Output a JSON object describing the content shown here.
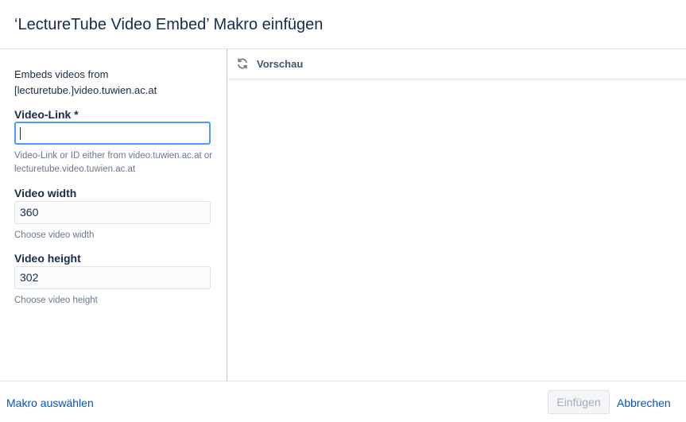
{
  "dialog": {
    "title": "‘LectureTube Video Embed’ Makro einfügen"
  },
  "form": {
    "description": "Embeds videos from [lecturetube.]video.tuwien.ac.at",
    "video_link": {
      "label": "Video-Link *",
      "value": "",
      "help": "Video-Link or ID either from video.tuwien.ac.at or lecturetube.video.tuwien.ac.at"
    },
    "video_width": {
      "label": "Video width",
      "value": "360",
      "help": "Choose video width"
    },
    "video_height": {
      "label": "Video height",
      "value": "302",
      "help": "Choose video height"
    }
  },
  "preview": {
    "label": "Vorschau",
    "icon": "refresh-icon"
  },
  "footer": {
    "select_macro_link": "Makro auswählen",
    "insert_button": "Einfügen",
    "cancel_link": "Abbrechen"
  },
  "colors": {
    "link": "#0052cc",
    "focus_border": "#4c9aff",
    "text": "#172b4d",
    "muted": "#6b778c"
  }
}
